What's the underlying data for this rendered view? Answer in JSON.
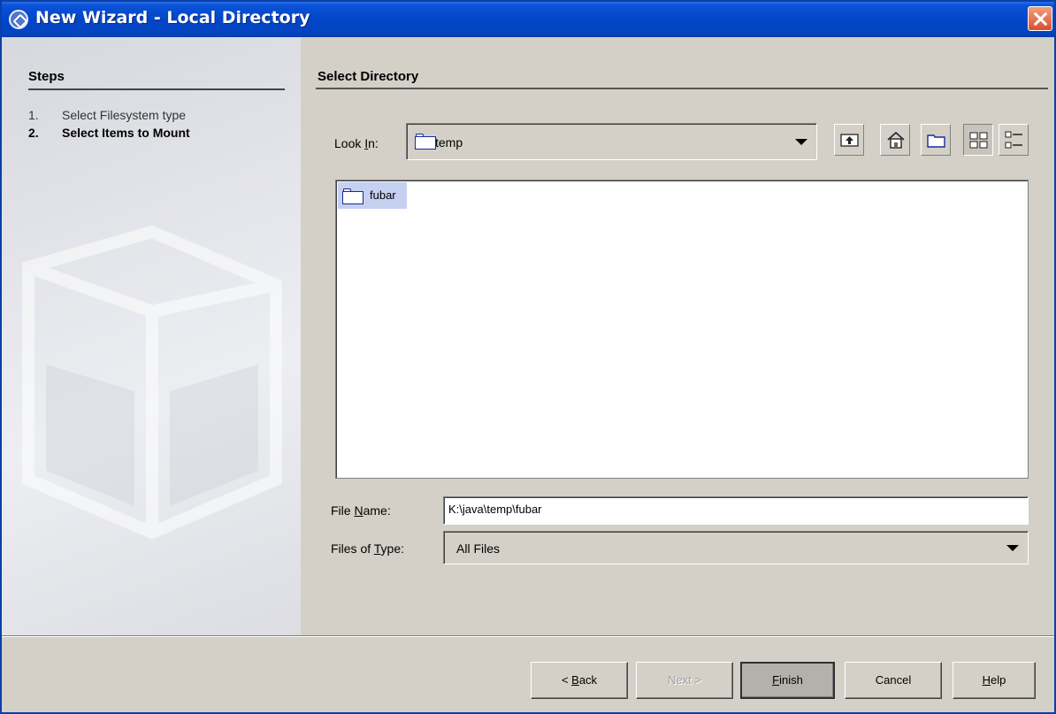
{
  "window": {
    "title": "New Wizard - Local Directory"
  },
  "steps": {
    "title": "Steps",
    "items": [
      {
        "number": "1.",
        "label": "Select Filesystem type",
        "state": "done"
      },
      {
        "number": "2.",
        "label": "Select Items to Mount",
        "state": "current"
      }
    ]
  },
  "content": {
    "title": "Select Directory",
    "look_in": {
      "label_pre": "Look ",
      "label_mnemonic": "I",
      "label_post": "n:",
      "value": "temp"
    },
    "toolbar": [
      {
        "name": "up-one-level-icon"
      },
      {
        "name": "home-icon"
      },
      {
        "name": "new-folder-icon"
      },
      {
        "name": "list-view-icon",
        "pressed": true
      },
      {
        "name": "details-view-icon"
      }
    ],
    "files": [
      {
        "name": "fubar",
        "type": "folder",
        "selected": true
      }
    ],
    "file_name": {
      "label_pre": "File ",
      "label_mnemonic": "N",
      "label_post": "ame:",
      "value": "K:\\java\\temp\\fubar"
    },
    "files_of_type": {
      "label_pre": "Files of ",
      "label_mnemonic": "T",
      "label_post": "ype:",
      "value": "All Files"
    }
  },
  "buttons": {
    "back": {
      "pre": "< ",
      "mnemonic": "B",
      "post": "ack"
    },
    "next": {
      "label": "Next >"
    },
    "finish": {
      "pre": "",
      "mnemonic": "F",
      "post": "inish"
    },
    "cancel": {
      "label": "Cancel"
    },
    "help": {
      "pre": "",
      "mnemonic": "H",
      "post": "elp"
    }
  },
  "colors": {
    "titlebar": "#0246c8",
    "selection": "#c6d0f0",
    "dialog_bg": "#d4d0c8"
  }
}
